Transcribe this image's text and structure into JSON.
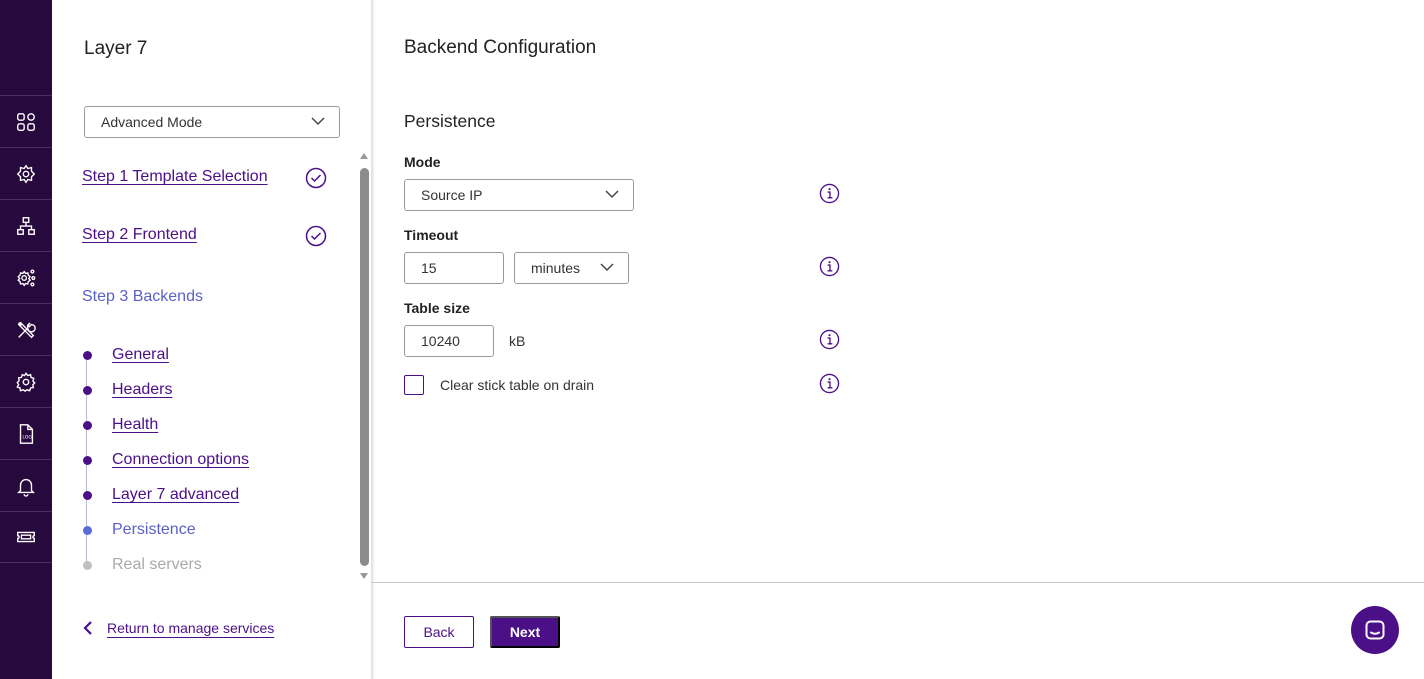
{
  "colors": {
    "brand": "#4b0f87",
    "rail": "#28093d",
    "current_step": "#5b5fc7",
    "pending_step": "#aaaaaa"
  },
  "rail": {
    "icons": [
      "dashboard-icon",
      "services-icon",
      "network-icon",
      "cluster-settings-icon",
      "tools-icon",
      "settings-icon",
      "log-icon",
      "bell-icon",
      "ticket-icon"
    ]
  },
  "wizard": {
    "title": "Layer 7",
    "mode_select": {
      "value": "Advanced Mode"
    },
    "steps": [
      {
        "label": "Step 1 Template Selection",
        "status": "complete"
      },
      {
        "label": "Step 2 Frontend",
        "status": "complete"
      },
      {
        "label": "Step 3 Backends",
        "status": "current"
      }
    ],
    "substeps": [
      {
        "label": "General",
        "status": "complete"
      },
      {
        "label": "Headers",
        "status": "complete"
      },
      {
        "label": "Health",
        "status": "complete"
      },
      {
        "label": "Connection options",
        "status": "complete"
      },
      {
        "label": "Layer 7 advanced",
        "status": "complete"
      },
      {
        "label": "Persistence",
        "status": "current"
      },
      {
        "label": "Real servers",
        "status": "pending"
      }
    ],
    "return_link": "Return to manage services"
  },
  "main": {
    "title": "Backend Configuration",
    "section": "Persistence",
    "mode": {
      "label": "Mode",
      "value": "Source IP"
    },
    "timeout": {
      "label": "Timeout",
      "value": "15",
      "unit_value": "minutes"
    },
    "table_size": {
      "label": "Table size",
      "value": "10240",
      "unit": "kB"
    },
    "clear_stick": {
      "label": "Clear stick table on drain",
      "checked": false
    }
  },
  "footer": {
    "back_label": "Back",
    "next_label": "Next"
  }
}
